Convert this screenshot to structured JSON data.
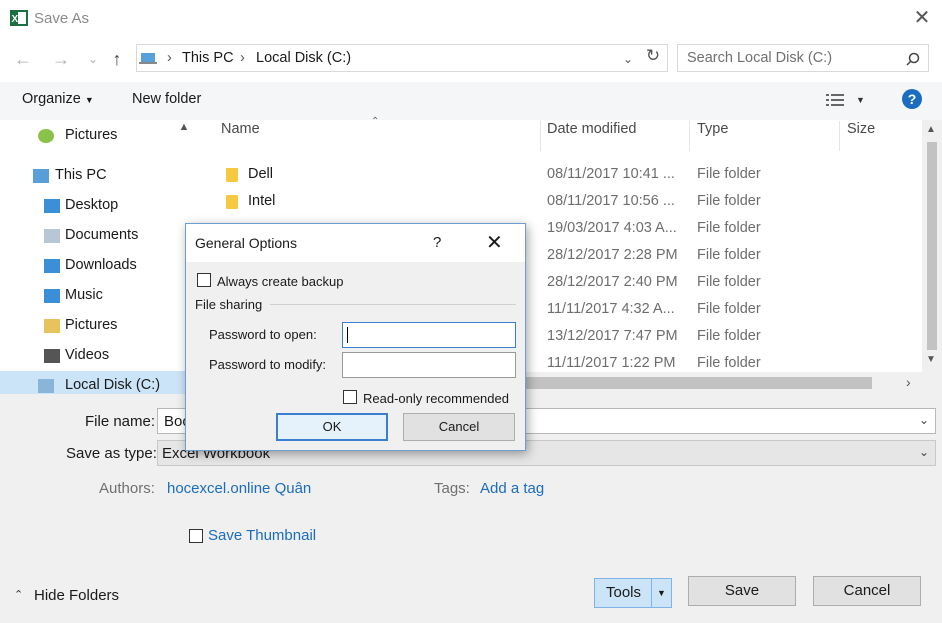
{
  "window": {
    "title": "Save As"
  },
  "nav": {
    "breadcrumb": [
      "This PC",
      "Local Disk (C:)"
    ],
    "search_placeholder": "Search Local Disk (C:)"
  },
  "toolbar": {
    "organize": "Organize",
    "new_folder": "New folder"
  },
  "sidebar": {
    "items": [
      {
        "label": "Pictures"
      },
      {
        "label": "This PC"
      },
      {
        "label": "Desktop"
      },
      {
        "label": "Documents"
      },
      {
        "label": "Downloads"
      },
      {
        "label": "Music"
      },
      {
        "label": "Pictures"
      },
      {
        "label": "Videos"
      },
      {
        "label": "Local Disk (C:)"
      }
    ]
  },
  "file_list": {
    "columns": [
      "Name",
      "Date modified",
      "Type",
      "Size"
    ],
    "rows": [
      {
        "name": "Dell",
        "date": "08/11/2017 10:41 ...",
        "type": "File folder"
      },
      {
        "name": "Intel",
        "date": "08/11/2017 10:56 ...",
        "type": "File folder"
      },
      {
        "name": "",
        "date": "19/03/2017 4:03 A...",
        "type": "File folder"
      },
      {
        "name": "",
        "date": "28/12/2017 2:28 PM",
        "type": "File folder"
      },
      {
        "name": "",
        "date": "28/12/2017 2:40 PM",
        "type": "File folder"
      },
      {
        "name": "",
        "date": "11/11/2017 4:32 A...",
        "type": "File folder"
      },
      {
        "name": "",
        "date": "13/12/2017 7:47 PM",
        "type": "File folder"
      },
      {
        "name": "",
        "date": "11/11/2017 1:22 PM",
        "type": "File folder"
      }
    ]
  },
  "form": {
    "file_name_label": "File name:",
    "file_name_value": "Boo",
    "save_type_label": "Save as type:",
    "save_type_value": "Excel Workbook",
    "authors_label": "Authors:",
    "authors_value": "hocexcel.online Quân",
    "tags_label": "Tags:",
    "tags_value": "Add a tag",
    "save_thumbnail": "Save Thumbnail"
  },
  "footer": {
    "hide_folders": "Hide Folders",
    "tools": "Tools",
    "save": "Save",
    "cancel": "Cancel"
  },
  "dialog": {
    "title": "General Options",
    "help": "?",
    "always_backup": "Always create backup",
    "file_sharing": "File sharing",
    "password_open": "Password to open:",
    "password_modify": "Password to modify:",
    "read_only": "Read-only recommended",
    "ok": "OK",
    "cancel": "Cancel"
  },
  "colors": {
    "accent": "#1a6dbf",
    "selection": "#cce4f7",
    "folder": "#f5c942"
  }
}
